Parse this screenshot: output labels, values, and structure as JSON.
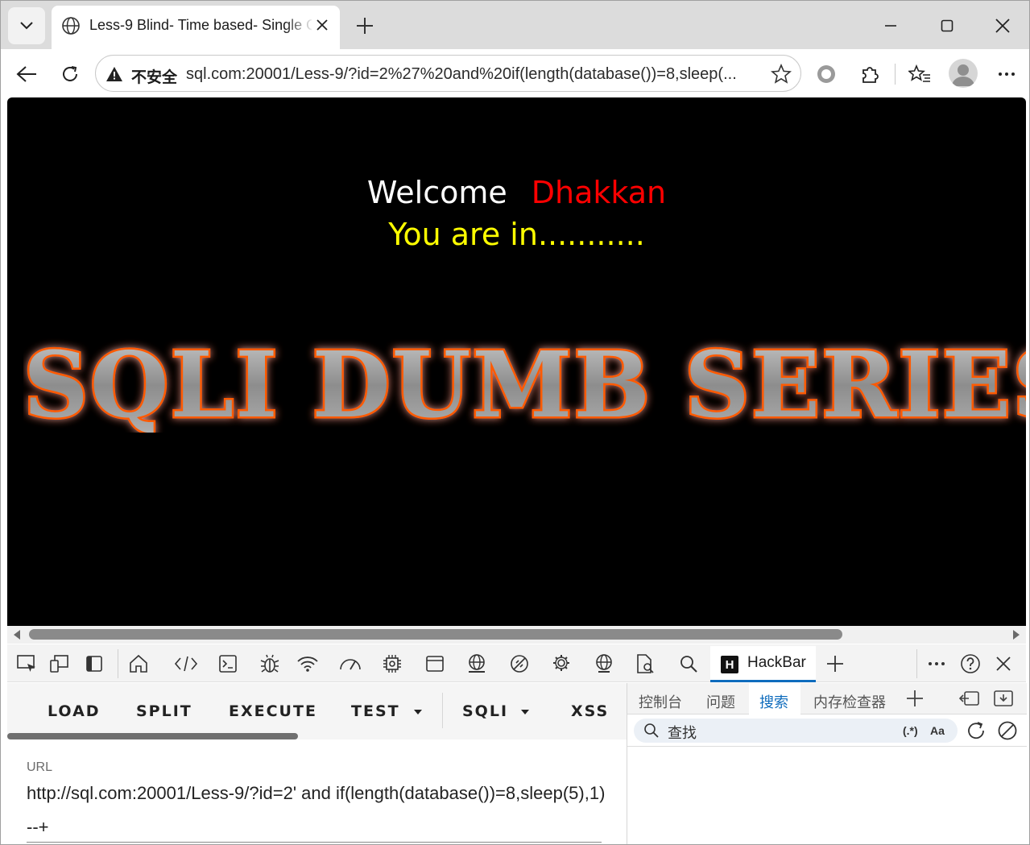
{
  "browser": {
    "tab_title": "Less-9 Blind- Time based- Single Q",
    "insecure_label": "不安全",
    "address": "sql.com:20001/Less-9/?id=2%27%20and%20if(length(database())=8,sleep(..."
  },
  "page": {
    "welcome": "Welcome",
    "name": "Dhakkan",
    "status": "You are in...........",
    "logo_text": "SQLI DUMB SERIES"
  },
  "devtools": {
    "hackbar_tab": "HackBar",
    "hackbar": {
      "buttons": [
        "LOAD",
        "SPLIT",
        "EXECUTE",
        "TEST",
        "SQLI",
        "XSS"
      ],
      "url_label": "URL",
      "url_value": "http://sql.com:20001/Less-9/?id=2' and if(length(database())=8,sleep(5),1) --+"
    },
    "drawer": {
      "tabs": [
        "控制台",
        "问题",
        "搜索",
        "内存检查器"
      ],
      "active_tab": "搜索",
      "search_placeholder": "查找",
      "regex_label": "(.*)",
      "case_label": "Aa"
    }
  },
  "colors": {
    "welcome": "#ffffff",
    "name": "#ff0000",
    "status": "#ffff00",
    "accent": "#0f6cbd"
  }
}
